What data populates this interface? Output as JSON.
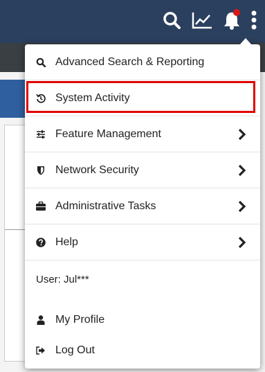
{
  "menu": {
    "items": [
      {
        "label": "Advanced Search & Reporting",
        "icon": "search-icon"
      },
      {
        "label": "System Activity",
        "icon": "history-icon"
      },
      {
        "label": "Feature Management",
        "icon": "sliders-icon"
      },
      {
        "label": "Network Security",
        "icon": "shield-icon"
      },
      {
        "label": "Administrative Tasks",
        "icon": "briefcase-icon"
      },
      {
        "label": "Help",
        "icon": "question-circle-icon"
      }
    ],
    "user_label": "User: Jul***",
    "profile_label": "My Profile",
    "logout_label": "Log Out"
  },
  "colors": {
    "topbar": "#2b3f5e",
    "highlight": "#e00000",
    "notification_dot": "#d81818"
  }
}
